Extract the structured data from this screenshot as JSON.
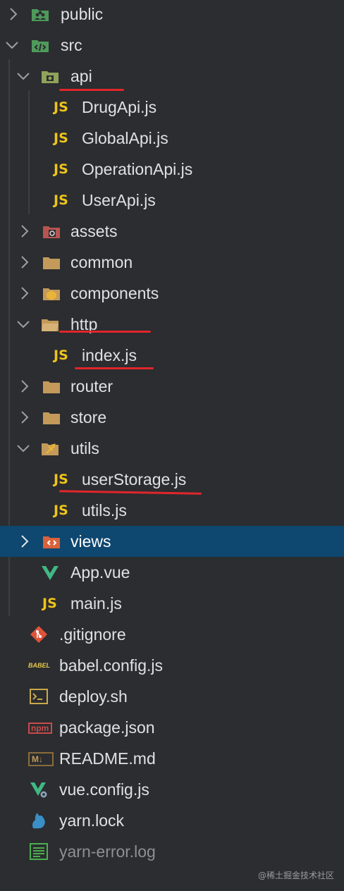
{
  "tree": {
    "public": "public",
    "src": "src",
    "api": "api",
    "drug_api": "DrugApi.js",
    "global_api": "GlobalApi.js",
    "operation_api": "OperationApi.js",
    "user_api": "UserApi.js",
    "assets": "assets",
    "common": "common",
    "components": "components",
    "http": "http",
    "index_js": "index.js",
    "router": "router",
    "store": "store",
    "utils": "utils",
    "user_storage": "userStorage.js",
    "utils_js": "utils.js",
    "views": "views",
    "app_vue": "App.vue",
    "main_js": "main.js",
    "gitignore": ".gitignore",
    "babel_config": "babel.config.js",
    "deploy_sh": "deploy.sh",
    "package_json": "package.json",
    "readme": "README.md",
    "vue_config": "vue.config.js",
    "yarn_lock": "yarn.lock",
    "yarn_error": "yarn-error.log"
  },
  "icons": {
    "js_glyph": "JS",
    "babel_glyph": "BABEL",
    "npm_glyph": "npm",
    "md_glyph": "M↓"
  },
  "watermark": "@稀土掘金技术社区",
  "colors": {
    "background": "#2b2d30",
    "selected_row": "#0e4770",
    "folder": "#c39a5a",
    "js": "#f0c419",
    "annotation_red": "#e0262b"
  }
}
